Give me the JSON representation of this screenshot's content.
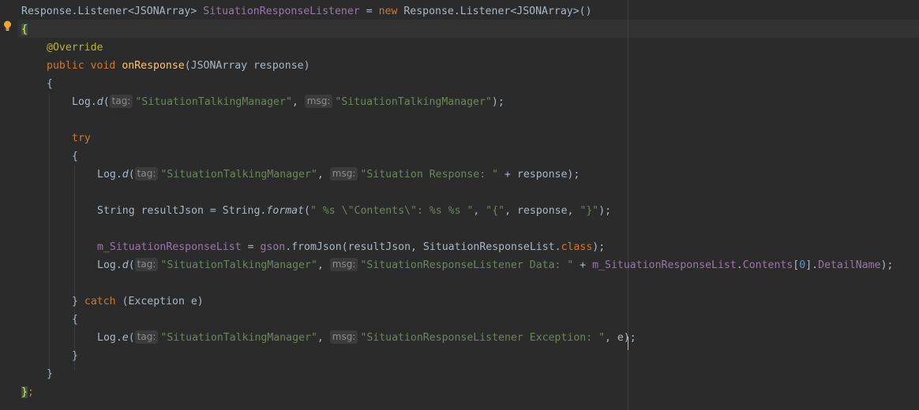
{
  "code": {
    "l1": {
      "t1": "Response.Listener<JSONArray> ",
      "t2": "SituationResponseListener",
      "t3": " = ",
      "t4": "new",
      "t5": " Response.Listener<JSONArray>()"
    },
    "l2": {
      "brace": "{"
    },
    "l3": {
      "ann": "@Override"
    },
    "l4": {
      "kw1": "public",
      "kw2": "void",
      "fn": "onResponse",
      "rest": "(JSONArray response)"
    },
    "l5": {
      "t": "{"
    },
    "l6": {
      "a": "Log.",
      "fn": "d",
      "b": "(",
      "tag": "tag:",
      "s1": "\"SituationTalkingManager\"",
      "c": ", ",
      "msg": "msg:",
      "s2": "\"SituationTalkingManager\"",
      "end": ");"
    },
    "l7": {
      "kw": "try"
    },
    "l8": {
      "t": "{"
    },
    "l9": {
      "a": "Log.",
      "fn": "d",
      "b": "(",
      "tag": "tag:",
      "s1": "\"SituationTalkingManager\"",
      "c": ", ",
      "msg": "msg:",
      "s2": "\"Situation Response: \"",
      "end": " + response);"
    },
    "l10": {
      "a": "String resultJson = String.",
      "fn": "format",
      "b": "(",
      "s1": "\" %s \\\"Contents\\\": %s %s \"",
      "c1": ", ",
      "s2": "\"{\"",
      "c2": ", response, ",
      "s3": "\"}\"",
      "end": ");"
    },
    "l11": {
      "f1": "m_SituationResponseList",
      "a": " = ",
      "f2": "gson",
      "b": ".fromJson(resultJson, SituationResponseList.",
      "kw": "class",
      "end": ");"
    },
    "l12": {
      "a": "Log.",
      "fn": "d",
      "b": "(",
      "tag": "tag:",
      "s1": "\"SituationTalkingManager\"",
      "c": ", ",
      "msg": "msg:",
      "s2": "\"SituationResponseListener Data: \"",
      "d": " + ",
      "f1": "m_SituationResponseList",
      "e": ".",
      "f2": "Contents",
      "g": "[",
      "num": "0",
      "h": "].",
      "f3": "DetailName",
      "end": ");"
    },
    "l13": {
      "a": "} ",
      "kw": "catch",
      "b": " (Exception e)"
    },
    "l14": {
      "t": "{"
    },
    "l15": {
      "a": "Log.",
      "fn": "e",
      "b": "(",
      "tag": "tag:",
      "s1": "\"SituationTalkingManager\"",
      "c": ", ",
      "msg": "msg:",
      "s2": "\"SituationResponseListener Exception: \"",
      "end": ", e);"
    },
    "l16": {
      "t": "}"
    },
    "l17": {
      "t": "}"
    },
    "l18": {
      "brace": "}",
      "semi": ";"
    }
  },
  "colors": {
    "background": "#2b2b2b",
    "keyword": "#cc7832",
    "string": "#6a8759",
    "field": "#9876aa",
    "method": "#ffc66d",
    "annotation": "#bbb529",
    "number": "#6897bb",
    "plain": "#a9b7c6"
  },
  "icons": {
    "gutter": "lightbulb-icon"
  }
}
